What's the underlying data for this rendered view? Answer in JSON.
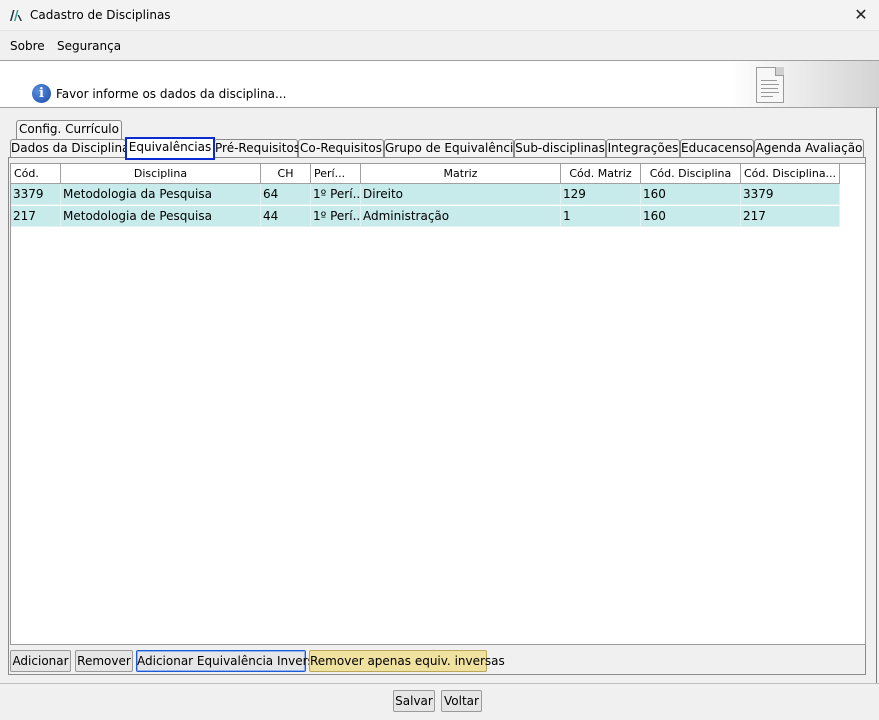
{
  "window": {
    "title": "Cadastro de Disciplinas",
    "close_symbol": "✕",
    "icon": "app-logo-icon"
  },
  "menu": {
    "items": [
      "Sobre",
      "Segurança"
    ]
  },
  "info": {
    "text": "Favor informe os dados da disciplina...",
    "icon": "info-icon",
    "info_glyph": "i",
    "doc_icon": "document-icon"
  },
  "tabs": {
    "row1": [
      "Config. Currículo"
    ],
    "row2": [
      "Dados da Disciplina",
      "Equivalências",
      "Pré-Requisitos",
      "Co-Requisitos",
      "Grupo de Equivalência",
      "Sub-disciplinas",
      "Integrações",
      "Educacenso",
      "Agenda Avaliação"
    ],
    "selected": "Equivalências"
  },
  "table": {
    "columns": [
      "Cód.",
      "Disciplina",
      "CH",
      "Perí...",
      "Matriz",
      "Cód. Matriz",
      "Cód. Disciplina",
      "Cód. Disciplina..."
    ],
    "rows": [
      [
        "3379",
        "Metodologia da Pesquisa",
        "64",
        "1º Perí...",
        "Direito",
        "129",
        "160",
        "3379"
      ],
      [
        "217",
        "Metodologia de Pesquisa",
        "44",
        "1º Perí...",
        "Administração",
        "1",
        "160",
        "217"
      ]
    ],
    "row_color": "#c7ebeb"
  },
  "buttons": {
    "adicionar": "Adicionar",
    "remover": "Remover",
    "adicionar_inversa": "Adicionar Equivalência Inversa",
    "remover_inversas": "Remover apenas equiv. inversas",
    "salvar": "Salvar",
    "voltar": "Voltar"
  },
  "colors": {
    "selected_tab_border": "#0a2ad4",
    "highlight_button": "#efe19e"
  }
}
